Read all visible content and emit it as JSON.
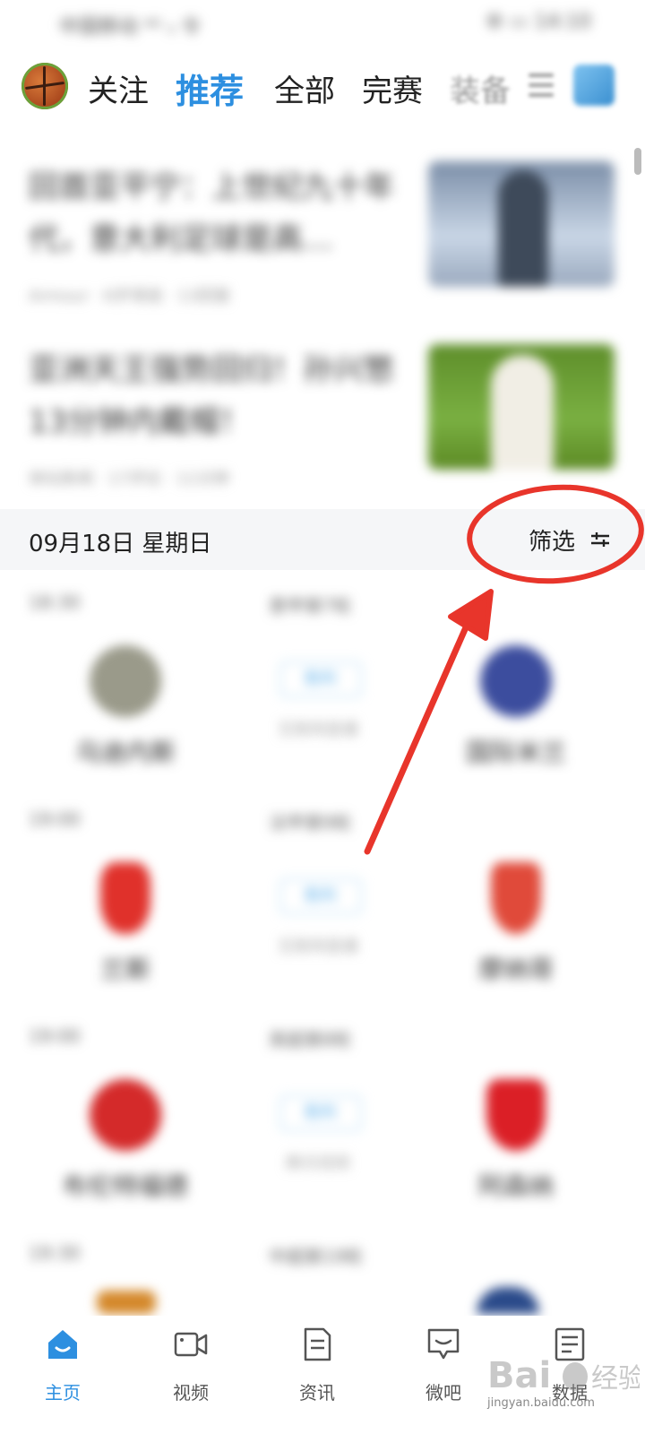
{
  "status_bar": {
    "left": "中国移动 ⁴ᴳ ᵢₗ 令",
    "right": "⚙ ▭ 14:10"
  },
  "top_nav": {
    "tabs": [
      {
        "label": "关注"
      },
      {
        "label": "推荐"
      },
      {
        "label": "全部"
      },
      {
        "label": "完赛"
      },
      {
        "label": "装备"
      }
    ]
  },
  "news": [
    {
      "title": "回首亚平宁：上世纪九十年代，意大利足球是高…",
      "meta": "Armour · 6岁球迷 · 13回复"
    },
    {
      "title": "亚洲天王强势回归！孙兴慜13分钟内戴帽！",
      "meta": "体坛新闻 · 17评论 · 11分钟"
    }
  ],
  "date_bar": {
    "date": "09月18日 星期日",
    "filter_label": "筛选"
  },
  "matches": [
    {
      "time": "18:30",
      "round": "意甲第7轮",
      "home": "乌迪内斯",
      "away": "国际米兰",
      "status": "胜利",
      "note": "互联网直播",
      "home_color": "#9a9a8a",
      "away_color": "#3c4d9e"
    },
    {
      "time": "19:00",
      "round": "法甲第9轮",
      "home": "兰斯",
      "away": "摩纳哥",
      "status": "胜利",
      "note": "互联网直播",
      "home_color": "#e0312b",
      "away_color": "#e04a3a"
    },
    {
      "time": "19:00",
      "round": "英超第8轮",
      "home": "布伦特福德",
      "away": "阿森纳",
      "status": "胜利",
      "note": "腾讯视频",
      "home_color": "#d42a2a",
      "away_color": "#db1f26"
    },
    {
      "time": "19:30",
      "round": "中超第19轮"
    }
  ],
  "bottom_tabs": [
    {
      "label": "主页"
    },
    {
      "label": "视频"
    },
    {
      "label": "资讯"
    },
    {
      "label": "微吧"
    },
    {
      "label": "数据"
    }
  ],
  "colors": {
    "accent": "#2d8fe0",
    "annotation": "#e8352b"
  },
  "watermark": {
    "text": "jingyan.baidu.com"
  }
}
